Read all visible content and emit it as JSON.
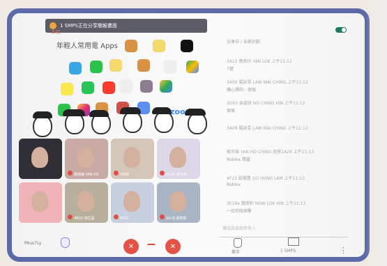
{
  "screen": {
    "title": "1 SMPS正在分享簡報畫面",
    "logo_text": "本校",
    "slide_title": "年輕人常用電 Apps",
    "bottom_left": "PAus7Ly",
    "controls": {
      "mic_icon": "mic-off-icon",
      "end_icon": "phone-icon",
      "camera_icon": "camera-off-icon"
    },
    "bottom_right": [
      "舉手",
      "1 SMPS"
    ]
  },
  "apps": [
    {
      "name": "pokemon-icon"
    },
    {
      "name": "avatar-icon"
    },
    {
      "name": "tiktok-icon"
    },
    {
      "name": "telegram-icon"
    },
    {
      "name": "line-icon"
    },
    {
      "name": "face-icon"
    },
    {
      "name": "game-icon"
    },
    {
      "name": "cloud-icon"
    },
    {
      "name": "maps-icon"
    },
    {
      "name": "snapchat-icon"
    },
    {
      "name": "whatsapp-icon"
    },
    {
      "name": "youtube-icon"
    },
    {
      "name": "mail-icon"
    },
    {
      "name": "star-icon"
    },
    {
      "name": "drive-icon"
    },
    {
      "name": "wechat-icon"
    },
    {
      "name": "instagram-icon"
    },
    {
      "name": "cartoon-icon"
    },
    {
      "name": "dictionary-icon"
    },
    {
      "name": "translate-icon"
    },
    {
      "name": "zoom-icon"
    }
  ],
  "zoom_label": "zoom",
  "video_tiles": [
    {
      "label": "",
      "style": "h"
    },
    {
      "label": "劉柏綸 YAN HO",
      "style": "b"
    },
    {
      "label": "3A08",
      "style": "c"
    },
    {
      "label": "4C24 李子晴",
      "style": "d"
    },
    {
      "label": "",
      "style": "e"
    },
    {
      "label": "4B02 林芷盈",
      "style": "f"
    },
    {
      "label": "4F21",
      "style": "g"
    },
    {
      "label": "3A18 蔡燕莉",
      "style": "i"
    }
  ],
  "chat": [
    {
      "sender": "",
      "text": "分享中 / 未來計劃"
    },
    {
      "sender": "3A11 蔡燕玲 YAN LUK 上午11:12",
      "text": "7號"
    },
    {
      "sender": "3A09 羅詠雯 LAW WAI CHING 上午11:12",
      "text": "傳心得的 - 保保"
    },
    {
      "sender": "2D03 吳姿妍 NG CHING HIN 上午11:12",
      "text": "保保"
    },
    {
      "sender": "3A09 羅詠雯 LAW WAI CHING 上午11:12",
      "text": ""
    },
    {
      "sender": "甄可瑜 YAN HO CHING 周恩1A29 上午11:13",
      "text": "Roblox 精靈"
    },
    {
      "sender": "4F23 歐陽豐 GO HUNG LAM 上午11:13",
      "text": "Roblox"
    },
    {
      "sender": "3E18a 魏睿軒 NGAI LOK HIN 上午11:13",
      "text": "一日的陰與擊"
    }
  ],
  "composer_placeholder": "傳送訊息給所有人"
}
